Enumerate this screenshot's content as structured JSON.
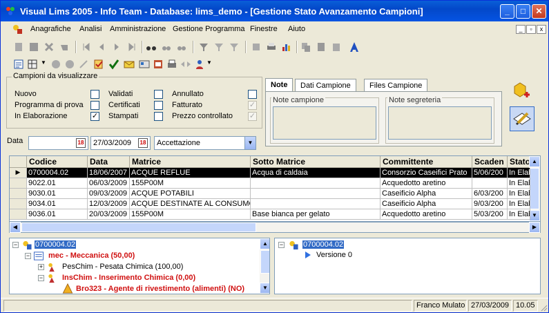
{
  "window": {
    "title": "Visual Lims 2005 - Info Team - Database: lims_demo - [Gestione Stato Avanzamento Campioni]",
    "min_label": "_",
    "max_label": "□",
    "close_label": "✕"
  },
  "menu": {
    "items": [
      "Anagrafiche",
      "Analisi",
      "Amministrazione",
      "Gestione Programma",
      "Finestre",
      "Aiuto"
    ],
    "mdi_min": "_",
    "mdi_restore": "▫",
    "mdi_close": "x"
  },
  "filters": {
    "group_label": "Campioni da visualizzare",
    "col1": [
      {
        "label": "Nuovo",
        "checked": false
      },
      {
        "label": "Programma di prova",
        "checked": false
      },
      {
        "label": "In Elaborazione",
        "checked": true
      }
    ],
    "col2": [
      {
        "label": "Validati",
        "checked": false
      },
      {
        "label": "Certificati",
        "checked": false
      },
      {
        "label": "Stampati",
        "checked": false
      }
    ],
    "col3": [
      {
        "label": "Annullato",
        "checked": false
      },
      {
        "label": "Fatturato",
        "checked": true
      },
      {
        "label": "Prezzo controllato",
        "checked": true
      }
    ],
    "date_label": "Data",
    "date_from": "",
    "date_to": "27/03/2009",
    "date_field": "Accettazione",
    "cal_icon_text": "18"
  },
  "tabs": {
    "items": [
      "Note",
      "Dati Campione",
      "Files Campione"
    ],
    "active": 0,
    "note_campione": "Note campione",
    "note_segreteria": "Note segreteria"
  },
  "grid": {
    "columns": [
      "Codice",
      "Data",
      "Matrice",
      "Sotto Matrice",
      "Committente",
      "Scaden",
      "Stato"
    ],
    "rows": [
      [
        "0700004.02",
        "18/06/2007",
        "ACQUE REFLUE",
        "Acqua di caldaia",
        "Consorzio Caseifici Prato",
        "5/06/200",
        "In Elab"
      ],
      [
        "9022.01",
        "06/03/2009",
        "155P00M",
        "",
        "Acquedotto aretino",
        "",
        "In Elab"
      ],
      [
        "9030.01",
        "09/03/2009",
        "ACQUE POTABILI",
        "",
        "Caseificio Alpha",
        "6/03/200",
        "In Elab"
      ],
      [
        "9034.01",
        "12/03/2009",
        "ACQUE DESTINATE AL CONSUMO",
        "",
        "Caseificio Alpha",
        "9/03/200",
        "In Elab"
      ],
      [
        "9036.01",
        "20/03/2009",
        "155P00M",
        "Base bianca per gelato",
        "Acquedotto aretino",
        "5/03/200",
        "In Elab"
      ]
    ],
    "selected_row": 0,
    "row_pointer": "▶"
  },
  "tree_left": {
    "root": "0700004.02",
    "n1": "mec - Meccanica (50,00)",
    "n2": "PesChim - Pesata Chimica (100,00)",
    "n3": "InsChim - Inserimento Chimica (0,00)",
    "n4": "Bro323 - Agente di rivestimento (alimenti) (NO)"
  },
  "tree_right": {
    "root": "0700004.02",
    "n1": "Versione 0"
  },
  "status": {
    "user": "Franco Mulato",
    "date": "27/03/2009",
    "time": "10.05"
  },
  "colors": {
    "title_bar": "#0554e3",
    "selection": "#000000",
    "tree_highlight": "#d01010",
    "tree_selected": "#316ac5"
  }
}
